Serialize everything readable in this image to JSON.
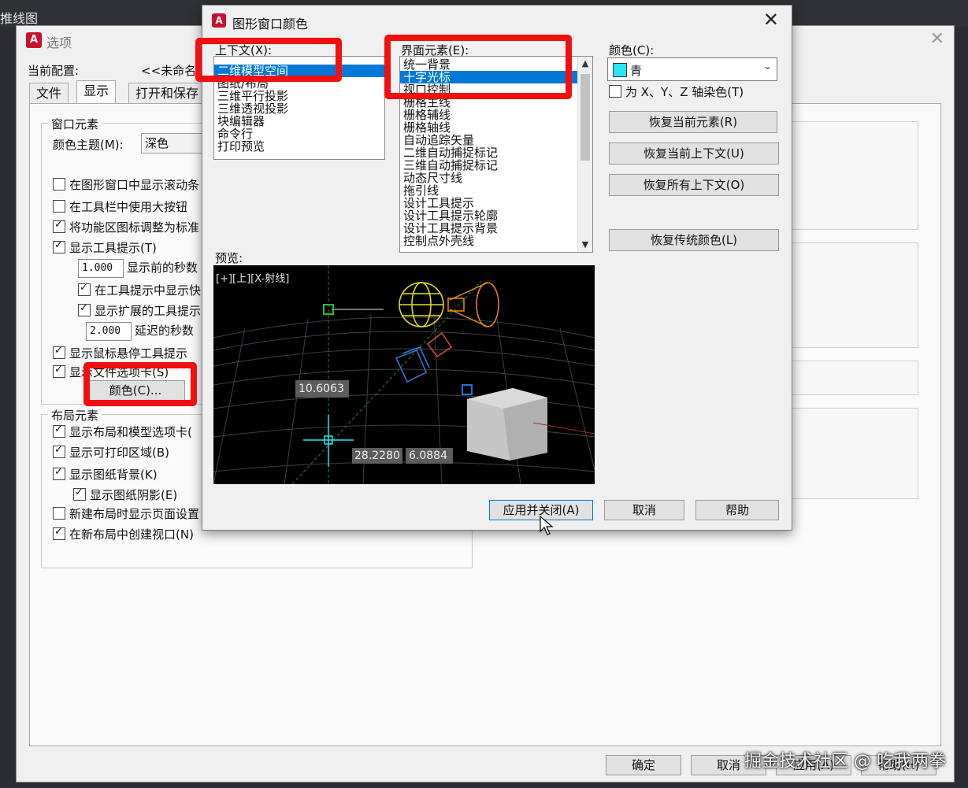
{
  "background_window": {
    "title_partial": "推线图"
  },
  "options": {
    "title": "选项",
    "profile_label": "当前配置:",
    "profile_value": "<<未命名",
    "tabs": [
      "文件",
      "显示",
      "打开和保存"
    ],
    "window_elements": {
      "title": "窗口元素",
      "color_scheme_label": "颜色主题(M):",
      "color_scheme_value": "深色",
      "checkboxes": [
        {
          "label": "在图形窗口中显示滚动条",
          "checked": false
        },
        {
          "label": "在工具栏中使用大按钮",
          "checked": false
        },
        {
          "label": "将功能区图标调整为标准",
          "checked": true
        },
        {
          "label": "显示工具提示(T)",
          "checked": true
        }
      ],
      "tooltip_delay_value": "1.000",
      "tooltip_delay_label": "显示前的秒数",
      "sub_checkboxes": [
        {
          "label": "在工具提示中显示快",
          "checked": true
        },
        {
          "label": "显示扩展的工具提示",
          "checked": true
        }
      ],
      "extended_delay_value": "2.000",
      "extended_delay_label": "延迟的秒数",
      "more_checkboxes": [
        {
          "label": "显示鼠标悬停工具提示",
          "checked": true
        },
        {
          "label": "显示文件选项卡(S)",
          "checked": true
        }
      ],
      "colors_button": "颜色(C)..."
    },
    "layout_elements": {
      "title": "布局元素",
      "checkboxes": [
        {
          "label": "显示布局和模型选项卡(",
          "checked": true
        },
        {
          "label": "显示可打印区域(B)",
          "checked": true
        },
        {
          "label": "显示图纸背景(K)",
          "checked": true
        },
        {
          "label": "显示图纸阴影(E)",
          "checked": true
        },
        {
          "label": "新建布局时显示页面设置",
          "checked": false
        },
        {
          "label": "在新布局中创建视口(N)",
          "checked": true
        }
      ]
    },
    "footer_buttons": [
      "确定",
      "取消",
      "应用(A)",
      "帮助(H)"
    ]
  },
  "dialog": {
    "title": "图形窗口颜色",
    "context_label": "上下文(X):",
    "contexts": [
      "二维模型空间",
      "图纸/布局",
      "三维平行投影",
      "三维透视投影",
      "块编辑器",
      "命令行",
      "打印预览"
    ],
    "context_selected": 0,
    "element_label": "界面元素(E):",
    "elements": [
      "统一背景",
      "十字光标",
      "视口控制",
      "栅格主线",
      "栅格辅线",
      "栅格轴线",
      "自动追踪矢量",
      "二维自动捕捉标记",
      "三维自动捕捉标记",
      "动态尺寸线",
      "拖引线",
      "设计工具提示",
      "设计工具提示轮廓",
      "设计工具提示背景",
      "控制点外壳线"
    ],
    "element_selected": 1,
    "color_label": "颜色(C):",
    "color_value": "青",
    "color_swatch": "#29e6f0",
    "tint_checkbox": {
      "label": "为 X、Y、Z 轴染色(T)",
      "checked": false
    },
    "buttons": {
      "restore_element": "恢复当前元素(R)",
      "restore_context": "恢复当前上下文(U)",
      "restore_all": "恢复所有上下文(O)",
      "restore_classic": "恢复传统颜色(L)",
      "apply_close": "应用并关闭(A)",
      "cancel": "取消",
      "help": "帮助"
    },
    "preview_label": "预览:",
    "preview": {
      "viewport_label": "[+][上][X-射线]",
      "dim_value_1": "10.6063",
      "dim_value_2": "28.2280",
      "dim_value_3": "6.0884"
    }
  },
  "highlight_color": "#f20f10",
  "watermark": "掘金技术社区 @ 吃我两拳"
}
